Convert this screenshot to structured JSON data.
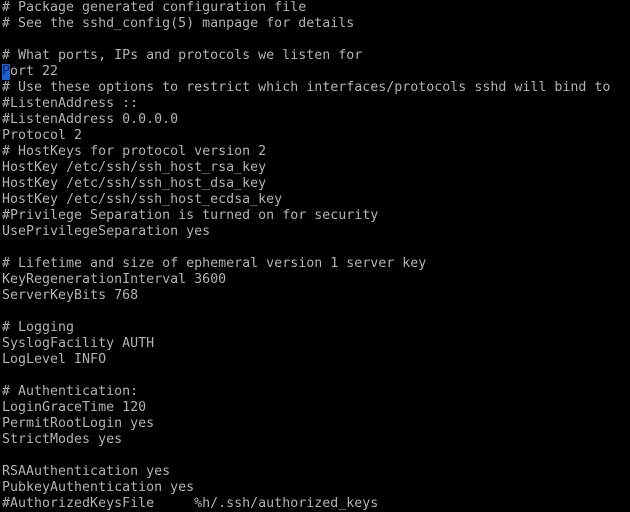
{
  "terminal": {
    "background_color": "#000000",
    "foreground_color": "#b2b2b2",
    "cursor_color": "#1e5fd0",
    "cursor_glyph_color": "#0b2a63",
    "columns": 78,
    "rows": 32,
    "cursor": {
      "row": 5,
      "column": 1,
      "char": "P"
    },
    "lines": [
      {
        "id": "line-1",
        "text": "# Package generated configuration file"
      },
      {
        "id": "line-2",
        "text": "# See the sshd_config(5) manpage for details"
      },
      {
        "id": "line-3",
        "text": ""
      },
      {
        "id": "line-4",
        "text": "# What ports, IPs and protocols we listen for"
      },
      {
        "id": "line-5",
        "text": "Port 22",
        "cursor_head": "P",
        "cursor_tail": "ort 22"
      },
      {
        "id": "line-6",
        "text": "# Use these options to restrict which interfaces/protocols sshd will bind to"
      },
      {
        "id": "line-7",
        "text": "#ListenAddress ::"
      },
      {
        "id": "line-8",
        "text": "#ListenAddress 0.0.0.0"
      },
      {
        "id": "line-9",
        "text": "Protocol 2"
      },
      {
        "id": "line-10",
        "text": "# HostKeys for protocol version 2"
      },
      {
        "id": "line-11",
        "text": "HostKey /etc/ssh/ssh_host_rsa_key"
      },
      {
        "id": "line-12",
        "text": "HostKey /etc/ssh/ssh_host_dsa_key"
      },
      {
        "id": "line-13",
        "text": "HostKey /etc/ssh/ssh_host_ecdsa_key"
      },
      {
        "id": "line-14",
        "text": "#Privilege Separation is turned on for security"
      },
      {
        "id": "line-15",
        "text": "UsePrivilegeSeparation yes"
      },
      {
        "id": "line-16",
        "text": ""
      },
      {
        "id": "line-17",
        "text": "# Lifetime and size of ephemeral version 1 server key"
      },
      {
        "id": "line-18",
        "text": "KeyRegenerationInterval 3600"
      },
      {
        "id": "line-19",
        "text": "ServerKeyBits 768"
      },
      {
        "id": "line-20",
        "text": ""
      },
      {
        "id": "line-21",
        "text": "# Logging"
      },
      {
        "id": "line-22",
        "text": "SyslogFacility AUTH"
      },
      {
        "id": "line-23",
        "text": "LogLevel INFO"
      },
      {
        "id": "line-24",
        "text": ""
      },
      {
        "id": "line-25",
        "text": "# Authentication:"
      },
      {
        "id": "line-26",
        "text": "LoginGraceTime 120"
      },
      {
        "id": "line-27",
        "text": "PermitRootLogin yes"
      },
      {
        "id": "line-28",
        "text": "StrictModes yes"
      },
      {
        "id": "line-29",
        "text": ""
      },
      {
        "id": "line-30",
        "text": "RSAAuthentication yes"
      },
      {
        "id": "line-31",
        "text": "PubkeyAuthentication yes"
      },
      {
        "id": "line-32",
        "text": "#AuthorizedKeysFile     %h/.ssh/authorized_keys"
      }
    ]
  }
}
